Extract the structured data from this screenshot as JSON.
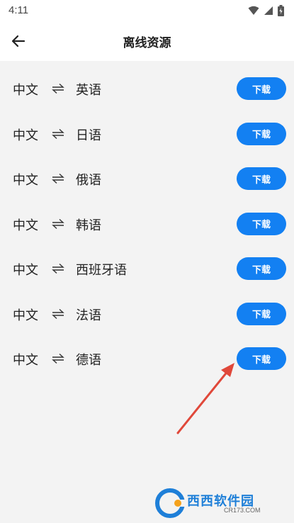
{
  "status": {
    "time": "4:11"
  },
  "header": {
    "title": "离线资源"
  },
  "resources": [
    {
      "from": "中文",
      "to": "英语",
      "button": "下载"
    },
    {
      "from": "中文",
      "to": "日语",
      "button": "下载"
    },
    {
      "from": "中文",
      "to": "俄语",
      "button": "下载"
    },
    {
      "from": "中文",
      "to": "韩语",
      "button": "下载"
    },
    {
      "from": "中文",
      "to": "西班牙语",
      "button": "下载"
    },
    {
      "from": "中文",
      "to": "法语",
      "button": "下载"
    },
    {
      "from": "中文",
      "to": "德语",
      "button": "下载"
    }
  ],
  "watermark": {
    "brand": "西西软件园",
    "site": "CR173.COM"
  },
  "colors": {
    "accent": "#1380f2",
    "annotation_arrow": "#e0483a",
    "background": "#f3f3f3"
  },
  "icons": {
    "back": "arrow-left-icon",
    "swap": "swap-arrows-icon",
    "wifi": "wifi-icon",
    "signal": "signal-icon",
    "battery": "battery-icon"
  }
}
